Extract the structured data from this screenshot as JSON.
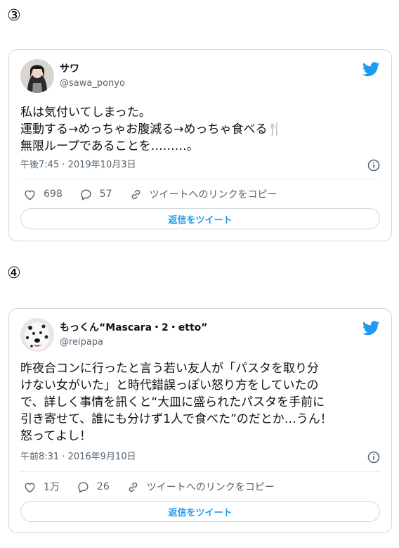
{
  "colors": {
    "accent": "#1d9bf0",
    "muted": "#536471",
    "border": "#cfd9de"
  },
  "tweets": [
    {
      "number": "③",
      "name": "サワ",
      "handle": "@sawa_ponyo",
      "text": "私は気付いてしまった。\n運動する→めっちゃお腹減る→めっちゃ食べる🍴\n無限ループであることを………。",
      "timestamp": "午後7:45 · 2019年10月3日",
      "likes": "698",
      "replies": "57",
      "copy_link": "ツイートへのリンクをコピー",
      "reply_button": "返信をツイート"
    },
    {
      "number": "④",
      "name": "もっくん“Mascara・2・etto”",
      "handle": "@reipapa",
      "text": "昨夜合コンに行ったと言う若い友人が「パスタを取り分\nけない女がいた」と時代錯誤っぽい怒り方をしていたの\nで、詳しく事情を訊くと“大皿に盛られたパスタを手前に\n引き寄せて、誰にも分けず1人で食べた”のだとか…うん！\n怒ってよし！",
      "timestamp": "午前8:31 · 2016年9月10日",
      "likes": "1万",
      "replies": "26",
      "copy_link": "ツイートへのリンクをコピー",
      "reply_button": "返信をツイート"
    }
  ]
}
